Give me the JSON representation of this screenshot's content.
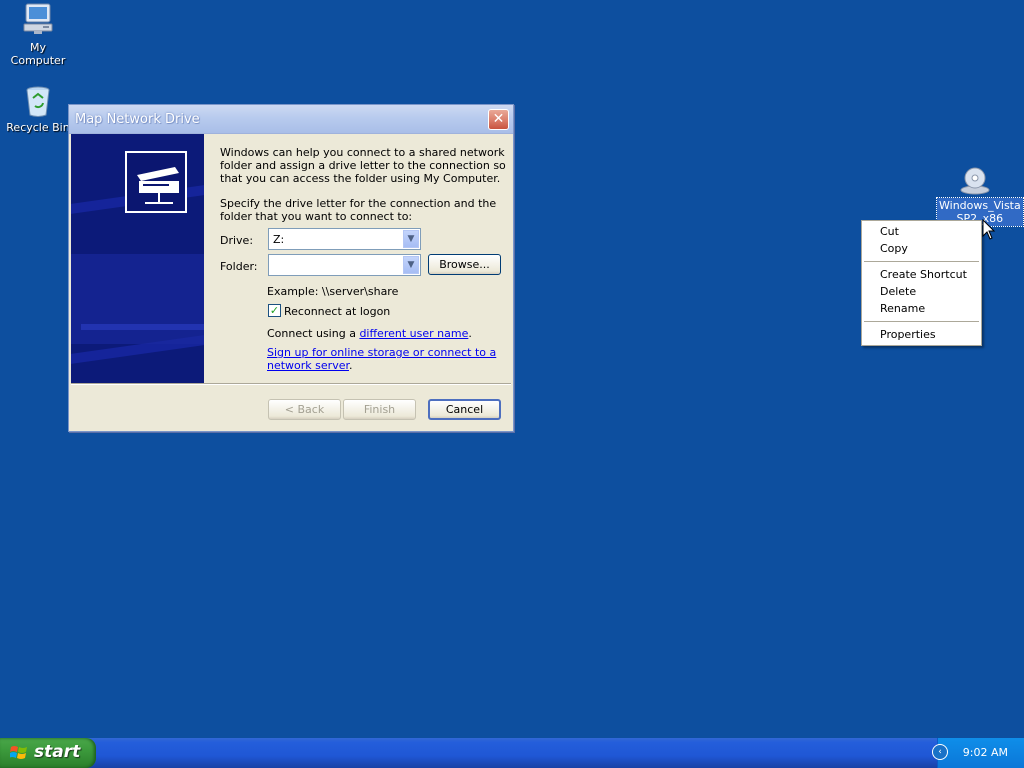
{
  "desktop": {
    "icons": [
      {
        "label": "My Computer",
        "icon": "my-computer-icon"
      },
      {
        "label": "Recycle Bin",
        "icon": "recycle-bin-icon"
      },
      {
        "label_line1": "Windows_Vista",
        "label_line2": "SP2_x86",
        "icon": "cd-drive-icon"
      }
    ]
  },
  "dialog": {
    "title": "Map Network Drive",
    "close_glyph": "✕",
    "intro": "Windows can help you connect to a shared network folder and assign a drive letter to the connection so that you can access the folder using My Computer.",
    "specify": "Specify the drive letter for the connection and the folder that you want to connect to:",
    "drive_label": "Drive:",
    "drive_value": "Z:",
    "folder_label": "Folder:",
    "folder_value": "",
    "browse_label": "Browse...",
    "example": "Example: \\\\server\\share",
    "reconnect_label": "Reconnect at logon",
    "reconnect_checked": true,
    "connect_using_prefix": "Connect using a ",
    "connect_using_link": "different user name",
    "connect_using_suffix": ".",
    "signup_link_line1": "Sign up for online storage or connect to a",
    "signup_link_line2": "network server",
    "signup_suffix": ".",
    "back_label": "< Back",
    "finish_label": "Finish",
    "cancel_label": "Cancel"
  },
  "context_menu": {
    "items": [
      "Cut",
      "Copy",
      "Create Shortcut",
      "Delete",
      "Rename",
      "Properties"
    ]
  },
  "taskbar": {
    "start_label": "start",
    "clock": "9:02 AM"
  },
  "colors": {
    "desktop": "#0d4f9f",
    "dialog_face": "#ece9d8",
    "banner": "#0c1a79",
    "start_green": "#3c9a3c",
    "taskbar_blue": "#245edb"
  }
}
